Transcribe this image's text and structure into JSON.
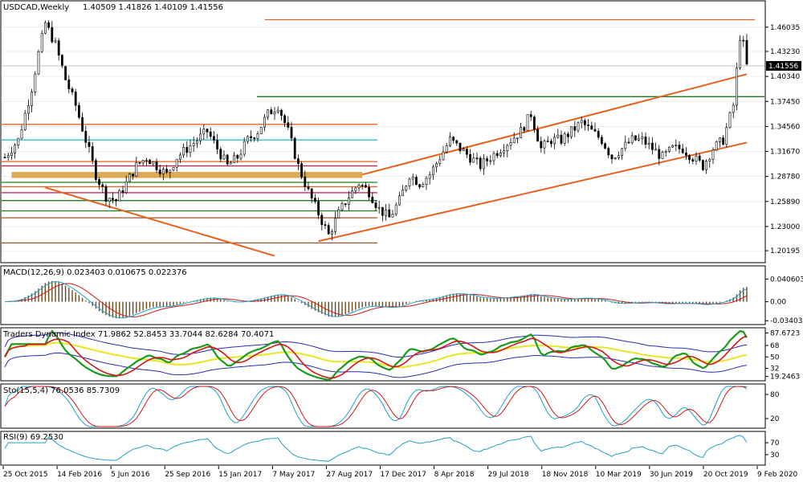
{
  "chart_data": {
    "type": "candlestick",
    "symbol_header": "USDCAD,Weekly",
    "ohlc_header": "1.40509 1.41826 1.40109 1.41556",
    "last_price": 1.41556,
    "last_price_label": "1.41556",
    "price_ylim": [
      1.19,
      1.475
    ],
    "price_ticks": [
      "1.46035",
      "1.43230",
      "1.40340",
      "1.37450",
      "1.34560",
      "1.31670",
      "1.28780",
      "1.25890",
      "1.23000",
      "1.20195"
    ],
    "x_labels": [
      "25 Oct 2015",
      "14 Feb 2016",
      "5 Jun 2016",
      "25 Sep 2016",
      "15 Jan 2017",
      "7 May 2017",
      "27 Aug 2017",
      "17 Dec 2017",
      "8 Apr 2018",
      "29 Jul 2018",
      "18 Nov 2018",
      "10 Mar 2019",
      "30 Jun 2019",
      "20 Oct 2019",
      "9 Feb 2020"
    ],
    "close_path": [
      [
        0,
        1.31
      ],
      [
        4,
        1.33
      ],
      [
        8,
        1.39
      ],
      [
        10,
        1.43
      ],
      [
        12,
        1.465
      ],
      [
        15,
        1.44
      ],
      [
        18,
        1.4
      ],
      [
        21,
        1.37
      ],
      [
        24,
        1.33
      ],
      [
        27,
        1.29
      ],
      [
        30,
        1.265
      ],
      [
        33,
        1.26
      ],
      [
        36,
        1.28
      ],
      [
        39,
        1.3
      ],
      [
        42,
        1.31
      ],
      [
        45,
        1.3
      ],
      [
        48,
        1.29
      ],
      [
        51,
        1.31
      ],
      [
        54,
        1.32
      ],
      [
        57,
        1.33
      ],
      [
        60,
        1.34
      ],
      [
        63,
        1.32
      ],
      [
        66,
        1.3
      ],
      [
        69,
        1.31
      ],
      [
        72,
        1.33
      ],
      [
        75,
        1.34
      ],
      [
        78,
        1.36
      ],
      [
        81,
        1.37
      ],
      [
        84,
        1.34
      ],
      [
        87,
        1.3
      ],
      [
        90,
        1.27
      ],
      [
        93,
        1.245
      ],
      [
        96,
        1.22
      ],
      [
        99,
        1.245
      ],
      [
        102,
        1.265
      ],
      [
        105,
        1.28
      ],
      [
        108,
        1.27
      ],
      [
        111,
        1.25
      ],
      [
        114,
        1.24
      ],
      [
        117,
        1.26
      ],
      [
        120,
        1.29
      ],
      [
        123,
        1.28
      ],
      [
        126,
        1.29
      ],
      [
        129,
        1.31
      ],
      [
        132,
        1.33
      ],
      [
        135,
        1.32
      ],
      [
        138,
        1.31
      ],
      [
        141,
        1.3
      ],
      [
        144,
        1.31
      ],
      [
        147,
        1.32
      ],
      [
        150,
        1.33
      ],
      [
        153,
        1.34
      ],
      [
        156,
        1.36
      ],
      [
        159,
        1.32
      ],
      [
        162,
        1.33
      ],
      [
        165,
        1.33
      ],
      [
        168,
        1.34
      ],
      [
        171,
        1.35
      ],
      [
        174,
        1.34
      ],
      [
        177,
        1.33
      ],
      [
        180,
        1.31
      ],
      [
        183,
        1.32
      ],
      [
        186,
        1.33
      ],
      [
        189,
        1.33
      ],
      [
        192,
        1.32
      ],
      [
        195,
        1.31
      ],
      [
        198,
        1.32
      ],
      [
        201,
        1.32
      ],
      [
        204,
        1.31
      ],
      [
        207,
        1.3
      ],
      [
        210,
        1.32
      ],
      [
        213,
        1.33
      ],
      [
        216,
        1.37
      ],
      [
        218,
        1.45
      ],
      [
        219,
        1.44
      ],
      [
        220,
        1.4155
      ]
    ],
    "bars_total": 221,
    "horizontal_levels": [
      {
        "price": 1.469,
        "color": "#e8601c"
      },
      {
        "price": 1.38,
        "color": "#1a7f1a"
      },
      {
        "price": 1.348,
        "color": "#e8601c"
      },
      {
        "price": 1.33,
        "color": "#33c0d0"
      },
      {
        "price": 1.305,
        "color": "#e8601c"
      },
      {
        "price": 1.3,
        "color": "#c8184c"
      },
      {
        "price": 1.281,
        "color": "#1a7f1a"
      },
      {
        "price": 1.276,
        "color": "#e8601c"
      },
      {
        "price": 1.269,
        "color": "#c8184c"
      },
      {
        "price": 1.26,
        "color": "#1a7f1a"
      },
      {
        "price": 1.248,
        "color": "#1a7f1a"
      },
      {
        "price": 1.24,
        "color": "#a0522d"
      },
      {
        "price": 1.211,
        "color": "#a0522d"
      }
    ],
    "zone": {
      "price_top": 1.293,
      "price_bottom": 1.286,
      "color": "#d4952a"
    },
    "channel_lines": [
      {
        "from": [
          93,
          1.213
        ],
        "to": [
          220,
          1.327
        ],
        "color": "#e8601c"
      },
      {
        "from": [
          106,
          1.29
        ],
        "to": [
          220,
          1.406
        ],
        "color": "#e8601c"
      },
      {
        "from": [
          12,
          1.275
        ],
        "to": [
          80,
          1.196
        ],
        "color": "#e8601c"
      }
    ],
    "macd": {
      "label": "MACD(12,26,9) 0.023403 0.010675 0.022376",
      "ticks": [
        "0.040603",
        "0.00",
        "-0.034038"
      ],
      "ylim": [
        -0.038,
        0.044
      ],
      "hist_color": "#6b4a1e",
      "signal_color": "#d01818",
      "main_color": "#22a0c8"
    },
    "tdi": {
      "label": "Traders Dynamic Index 71.9862 52.8453 33.7044 82.6284 70.4071",
      "ticks": [
        "87.6723",
        "68",
        "50",
        "32",
        "19.2463"
      ],
      "ylim": [
        15,
        92
      ],
      "colors": {
        "band": "#2a2ab8",
        "mid": "#e8e820",
        "rsi": "#1a9a1a",
        "signal": "#d01818"
      }
    },
    "stoch": {
      "label": "Sto(15,5,4) 76.0536 85.7309",
      "ticks": [
        "80",
        "20"
      ],
      "ylim": [
        0,
        100
      ],
      "colors": {
        "main": "#22a0c8",
        "signal": "#d01818"
      }
    },
    "rsi": {
      "label": "RSI(9) 69.2530",
      "ticks": [
        "70",
        "30"
      ],
      "ylim": [
        0,
        100
      ],
      "colors": {
        "line": "#22a0c8"
      }
    }
  }
}
